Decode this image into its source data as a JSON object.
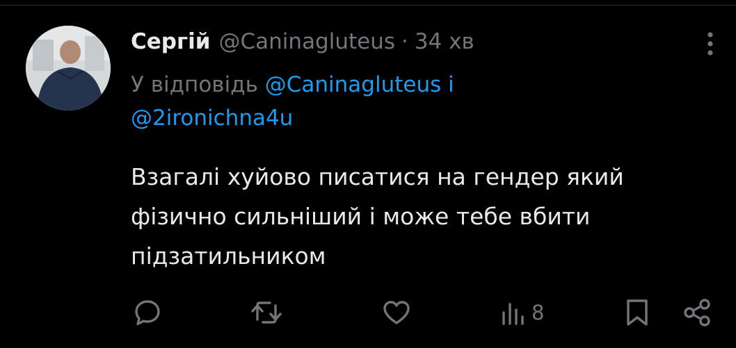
{
  "tweet": {
    "author_name": "Сергій",
    "author_handle": "@Caninagluteus",
    "separator": "·",
    "timestamp": "34 хв",
    "reply_prefix": "У відповідь",
    "reply_mentions": [
      "@Caninagluteus",
      "@2ironichna4u"
    ],
    "reply_joiner": "і",
    "text": "Взагалі хуйово писатися на гендер який фізично сильніший і може тебе вбити підзатильником"
  },
  "actions": {
    "reply_icon": "reply-icon",
    "retweet_icon": "retweet-icon",
    "like_icon": "heart-icon",
    "views_icon": "bar-chart-icon",
    "views_count": "8",
    "bookmark_icon": "bookmark-icon",
    "share_icon": "share-icon"
  },
  "colors": {
    "background": "#000000",
    "primary_text": "#e7e9ea",
    "secondary_text": "#71767b",
    "link": "#1d9bf0",
    "divider": "#2f3336"
  }
}
